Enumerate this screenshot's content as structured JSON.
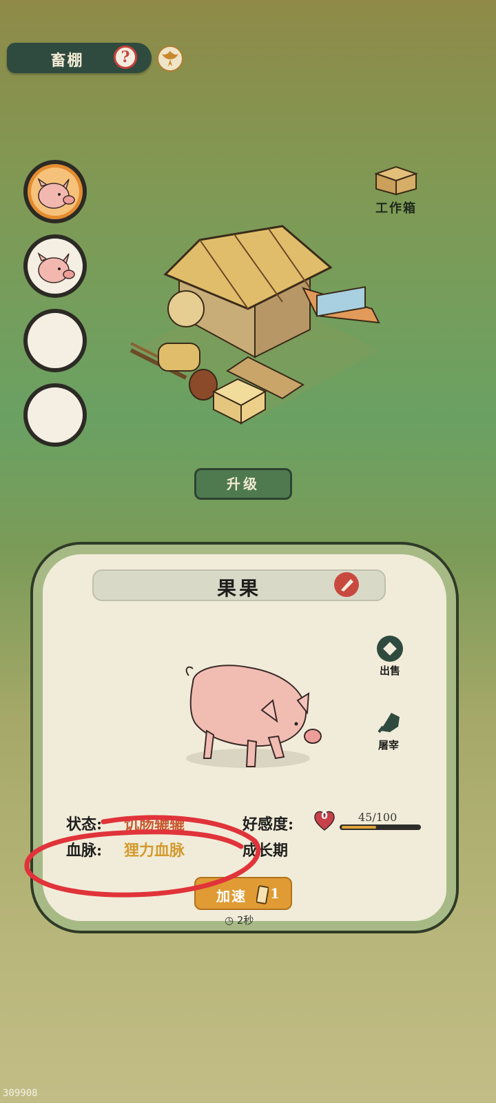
{
  "header": {
    "title": "畜棚",
    "help_symbol": "?"
  },
  "slots": [
    {
      "state": "pig",
      "active": true
    },
    {
      "state": "pig",
      "active": false
    },
    {
      "state": "empty",
      "active": false
    },
    {
      "state": "empty",
      "active": false
    }
  ],
  "workbox": {
    "label": "工作箱"
  },
  "upgrade": {
    "label": "升级"
  },
  "animal": {
    "name": "果果",
    "sell_label": "出售",
    "slaughter_label": "屠宰",
    "status_key": "状态:",
    "status_value": "饥肠辘辘",
    "bloodline_key": "血脉:",
    "bloodline_value": "狸力血脉",
    "affection_key": "好感度:",
    "affection_level": "0",
    "affection_value": "45/100",
    "affection_ratio": 0.45,
    "stage": "成长期"
  },
  "speedup": {
    "label": "加速",
    "count": "1",
    "timer": "2秒"
  },
  "watermark": "309908",
  "colors": {
    "accent_green": "#2f4a3f",
    "accent_orange": "#e09b34",
    "status_red": "#c85a32",
    "annotation_red": "#e0333a"
  }
}
